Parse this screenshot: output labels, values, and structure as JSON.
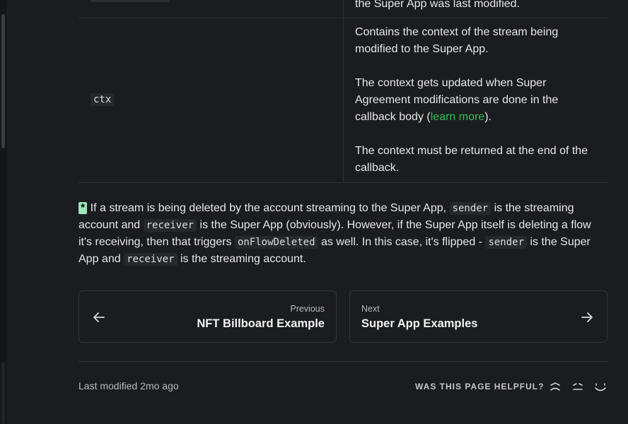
{
  "table": {
    "prev_row_text": "the Super App was last modified.",
    "ctx_param": "ctx",
    "ctx_desc_1": "Contains the context of the stream being modified to the Super App.",
    "ctx_desc_2_pre": "The context gets updated when Super Agreement modifications are done in the callback body (",
    "ctx_desc_2_link": "learn more",
    "ctx_desc_2_post": ").",
    "ctx_desc_3": "The context must be returned at the end of the callback."
  },
  "note": {
    "marker": "*",
    "t1": " If a stream is being deleted by the account streaming to the Super App, ",
    "c1": "sender",
    "t2": " is the streaming account and ",
    "c2": "receiver",
    "t3": " is the Super App (obviously). However, if the Super App itself is deleting a flow it's receiving, then that triggers ",
    "c3": "onFlowDeleted",
    "t4": " as well. In this case, it's flipped - ",
    "c4": "sender",
    "t5": " is the Super App and ",
    "c5": "receiver",
    "t6": " is the streaming account."
  },
  "pagination": {
    "prev_small": "Previous",
    "prev_title": "NFT Billboard Example",
    "next_small": "Next",
    "next_title": "Super App Examples"
  },
  "footer": {
    "last_modified": "Last modified 2mo ago",
    "helpful_q": "WAS THIS PAGE HELPFUL?"
  },
  "icons": {
    "prev": "arrow-left-icon",
    "next": "arrow-right-icon",
    "sad": "sad-face-icon",
    "neutral": "neutral-face-icon",
    "happy": "happy-face-icon"
  },
  "colors": {
    "background": "#1b1c1f",
    "link": "#2fbf5b",
    "asterisk_bg": "#9ce7b8"
  }
}
